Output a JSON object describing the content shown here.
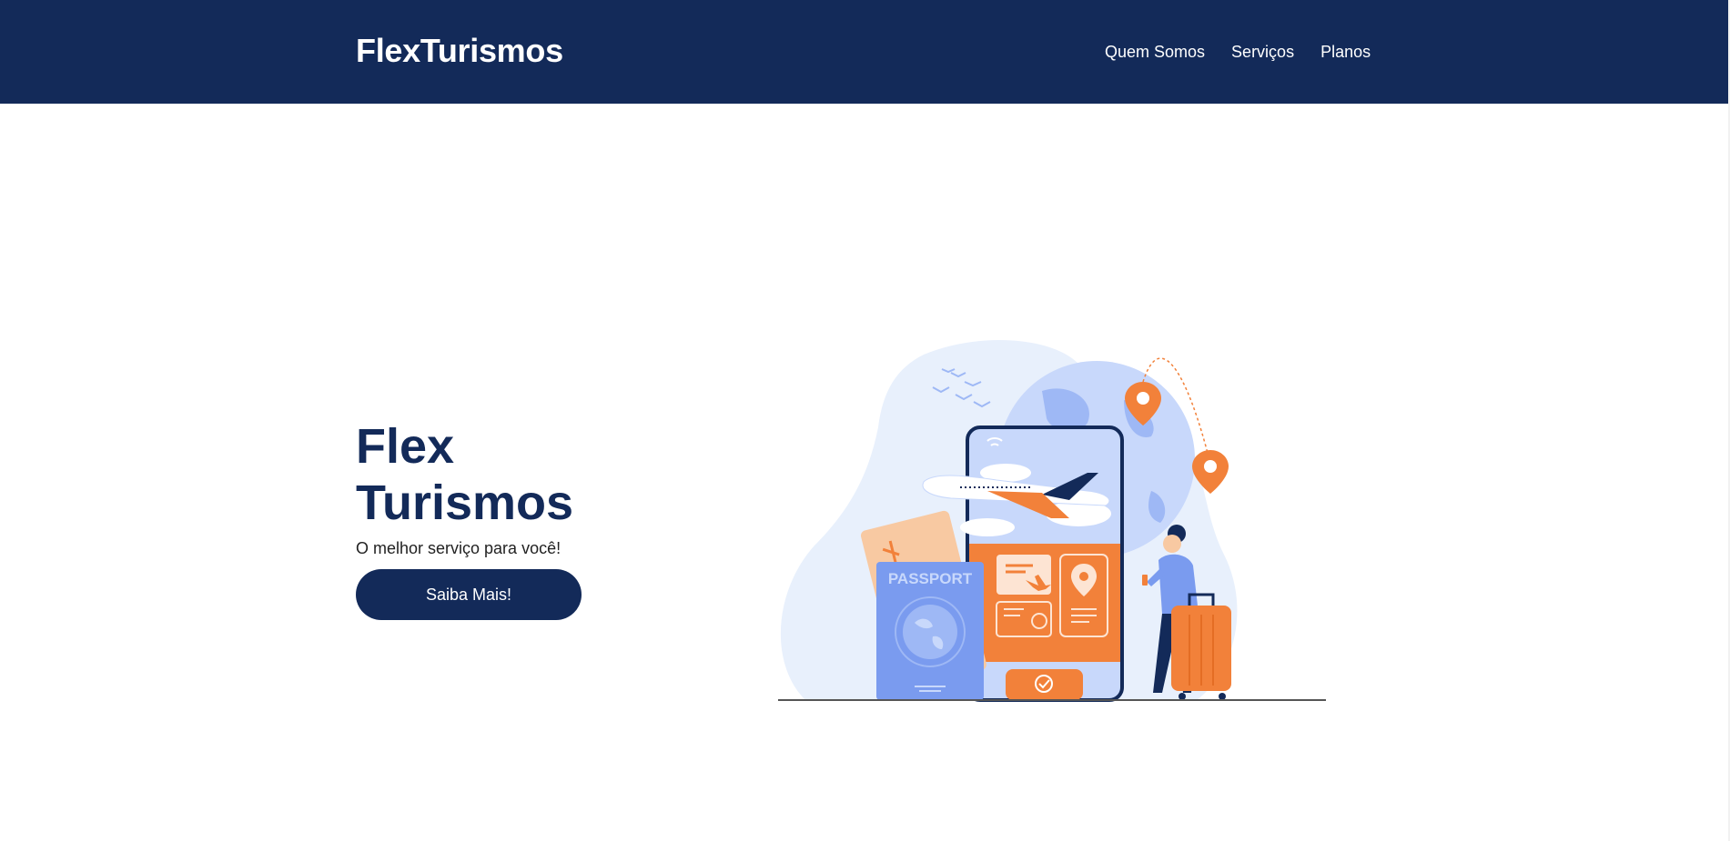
{
  "header": {
    "brand": "FlexTurismos",
    "nav": [
      "Quem Somos",
      "Serviços",
      "Planos"
    ]
  },
  "hero": {
    "title": "Flex Turismos",
    "subtitle": "O melhor serviço para você!",
    "cta_label": "Saiba Mais!",
    "illustration": {
      "passport_label": "PASSPORT",
      "icons": [
        "airplane-icon",
        "location-pin-icon",
        "wifi-icon",
        "check-icon",
        "clock-icon",
        "globe-icon",
        "luggage-icon"
      ]
    }
  },
  "colors": {
    "primary": "#132a59",
    "accent_orange": "#f2813a",
    "illustration_blue": "#7a9bef",
    "illustration_light_blue": "#e8f0fc"
  }
}
